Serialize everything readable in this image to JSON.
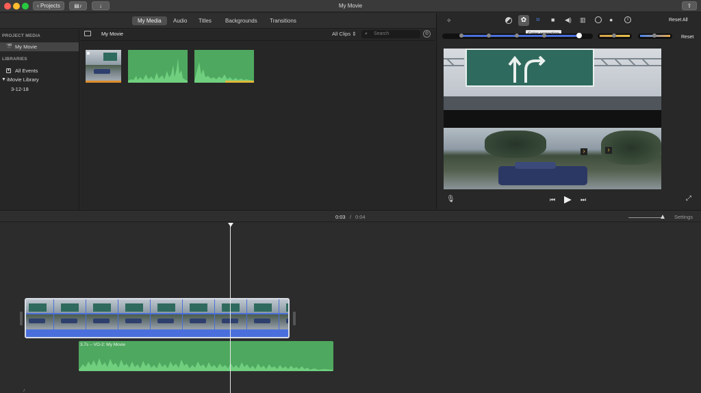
{
  "window": {
    "title": "My Movie",
    "projects_button": "Projects",
    "traffic_colors": [
      "#ff5f57",
      "#febc2e",
      "#28c840"
    ]
  },
  "tabs": {
    "items": [
      "My Media",
      "Audio",
      "Titles",
      "Backgrounds",
      "Transitions"
    ],
    "selected": "My Media"
  },
  "sidebar": {
    "project_media_header": "PROJECT MEDIA",
    "project_item": "My Movie",
    "libraries_header": "LIBRARIES",
    "all_events": "All Events",
    "library": "iMovie Library",
    "event": "3-12-18"
  },
  "browser": {
    "title": "My Movie",
    "filter": "All Clips",
    "search_placeholder": "Search"
  },
  "viewer": {
    "reset_all": "Reset All",
    "reset": "Reset",
    "tooltip": "Color correction",
    "toolbar_icons": [
      "magic-wand-icon",
      "color-balance-icon",
      "color-correction-icon",
      "crop-icon",
      "stabilization-icon",
      "volume-icon",
      "noise-reduction-icon",
      "speed-icon",
      "filter-icon",
      "info-icon"
    ]
  },
  "timeline": {
    "current_time": "0:03",
    "separator": "/",
    "total_time": "0:04",
    "settings": "Settings",
    "audio_clip_label": "3.7s – VO-2: My Movie"
  },
  "colors": {
    "accent": "#4a6fdc",
    "audio_green": "#4fa85f",
    "selection_yellow": "#f0c23b"
  }
}
